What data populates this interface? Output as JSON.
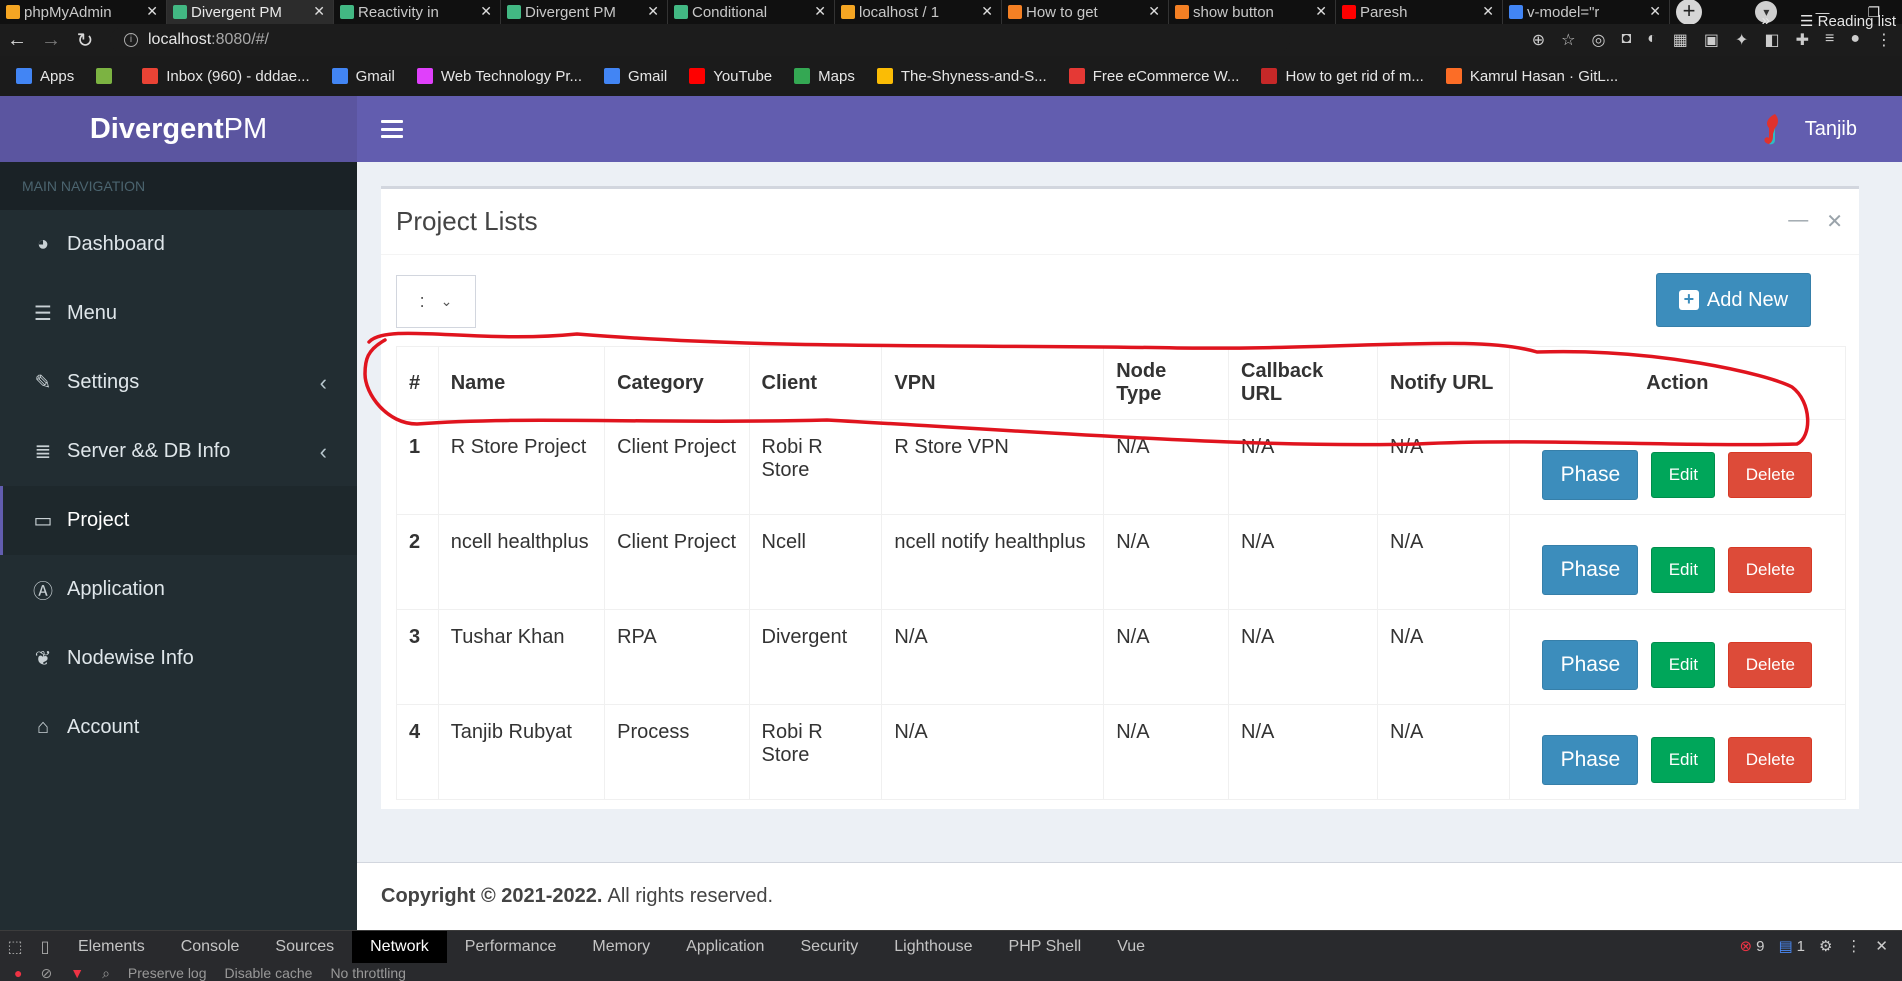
{
  "browser": {
    "tabs": [
      {
        "title": "phpMyAdmin",
        "color": "#f5a623"
      },
      {
        "title": "Divergent PM",
        "color": "#42b883"
      },
      {
        "title": "Reactivity in",
        "color": "#42b883"
      },
      {
        "title": "Divergent PM",
        "color": "#42b883"
      },
      {
        "title": "Conditional",
        "color": "#42b883"
      },
      {
        "title": "localhost / 1",
        "color": "#f5a623"
      },
      {
        "title": "How to get",
        "color": "#f48024"
      },
      {
        "title": "show button",
        "color": "#f48024"
      },
      {
        "title": "Paresh",
        "color": "#ff0000"
      },
      {
        "title": "v-model=\"r",
        "color": "#4285f4"
      }
    ],
    "url_host": "localhost",
    "url_path": ":8080/#/",
    "bookmarks": [
      {
        "label": "Apps",
        "color": "#4285f4"
      },
      {
        "label": "",
        "color": "#7cb342"
      },
      {
        "label": "Inbox (960) - dddae...",
        "color": "#ea4335"
      },
      {
        "label": "Gmail",
        "color": "#4285f4"
      },
      {
        "label": "Web Technology Pr...",
        "color": "#e040fb"
      },
      {
        "label": "Gmail",
        "color": "#4285f4"
      },
      {
        "label": "YouTube",
        "color": "#ff0000"
      },
      {
        "label": "Maps",
        "color": "#34a853"
      },
      {
        "label": "The-Shyness-and-S...",
        "color": "#fbbc05"
      },
      {
        "label": "Free eCommerce W...",
        "color": "#e53935"
      },
      {
        "label": "How to get rid of m...",
        "color": "#c62828"
      },
      {
        "label": "Kamrul Hasan · GitL...",
        "color": "#fc6d26"
      }
    ],
    "bookmarks_more": "»",
    "reading_list": "Reading list"
  },
  "app": {
    "brand_bold": "Divergent",
    "brand_light": "PM",
    "user_name": "Tanjib"
  },
  "sidebar": {
    "header": "MAIN NAVIGATION",
    "items": [
      {
        "label": "Dashboard",
        "icon": "dashboard-icon",
        "glyph": "◕"
      },
      {
        "label": "Menu",
        "icon": "menu-list-icon",
        "glyph": "☰"
      },
      {
        "label": "Settings",
        "icon": "wrench-icon",
        "glyph": "✎"
      },
      {
        "label": "Server && DB Info",
        "icon": "database-icon",
        "glyph": "≣"
      },
      {
        "label": "Project",
        "icon": "laptop-icon",
        "glyph": "▭"
      },
      {
        "label": "Application",
        "icon": "app-icon",
        "glyph": "Ⓐ"
      },
      {
        "label": "Nodewise Info",
        "icon": "node-icon",
        "glyph": "❦"
      },
      {
        "label": "Account",
        "icon": "bank-icon",
        "glyph": "⌂"
      }
    ]
  },
  "panel": {
    "title": "Project Lists",
    "per_page": ":",
    "add_new": "Add New"
  },
  "table": {
    "headers": [
      "#",
      "Name",
      "Category",
      "Client",
      "VPN",
      "Node Type",
      "Callback URL",
      "Notify URL",
      "Action"
    ],
    "rows": [
      {
        "num": "1",
        "name": "R Store Project",
        "category": "Client Project",
        "client": "Robi R Store",
        "vpn": "R Store VPN",
        "node_type": "N/A",
        "callback": "N/A",
        "notify": "N/A"
      },
      {
        "num": "2",
        "name": "ncell healthplus",
        "category": "Client Project",
        "client": "Ncell",
        "vpn": "ncell notify healthplus",
        "node_type": "N/A",
        "callback": "N/A",
        "notify": "N/A"
      },
      {
        "num": "3",
        "name": "Tushar Khan",
        "category": "RPA",
        "client": "Divergent",
        "vpn": "N/A",
        "node_type": "N/A",
        "callback": "N/A",
        "notify": "N/A"
      },
      {
        "num": "4",
        "name": "Tanjib Rubyat",
        "category": "Process",
        "client": "Robi R Store",
        "vpn": "N/A",
        "node_type": "N/A",
        "callback": "N/A",
        "notify": "N/A"
      }
    ],
    "actions": {
      "phase": "Phase",
      "edit": "Edit",
      "delete": "Delete"
    }
  },
  "footer": {
    "copyright_bold": "Copyright © 2021-2022.",
    "rights": "All rights reserved."
  },
  "devtools": {
    "tabs": [
      "Elements",
      "Console",
      "Sources",
      "Network",
      "Performance",
      "Memory",
      "Application",
      "Security",
      "Lighthouse",
      "PHP Shell",
      "Vue"
    ],
    "active_tab": "Network",
    "errors": "9",
    "messages": "1",
    "sub": [
      "Preserve log",
      "Disable cache",
      "No throttling"
    ]
  },
  "colors": {
    "header_purple": "#625daf",
    "sidebar_dark": "#222d32",
    "primary_blue": "#3c8dbc",
    "success_green": "#00a65a",
    "danger_red": "#dd4b39",
    "annotation_red": "#e0141e"
  }
}
